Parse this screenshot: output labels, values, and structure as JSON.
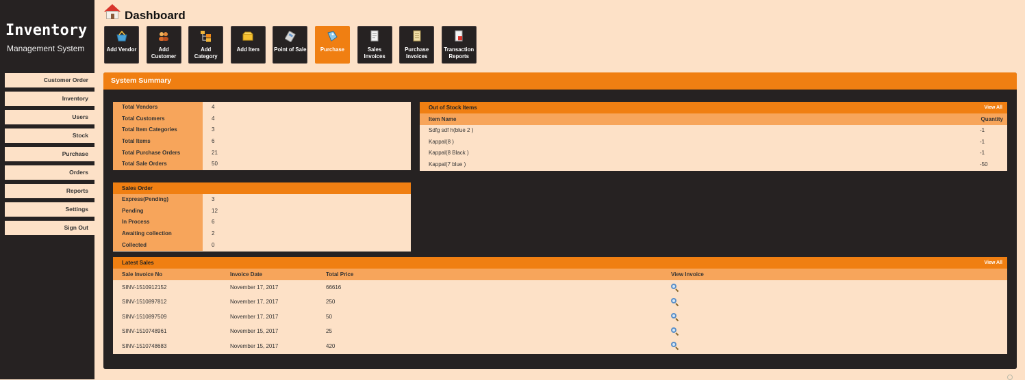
{
  "brand": {
    "title": "Inventory",
    "subtitle": "Management System"
  },
  "sidebar": {
    "items": [
      {
        "label": "Customer Order"
      },
      {
        "label": "Inventory"
      },
      {
        "label": "Users"
      },
      {
        "label": "Stock"
      },
      {
        "label": "Purchase"
      },
      {
        "label": "Orders"
      },
      {
        "label": "Reports"
      },
      {
        "label": "Settings"
      },
      {
        "label": "Sign Out"
      }
    ]
  },
  "header": {
    "title": "Dashboard",
    "icon": "house-icon"
  },
  "quick_actions": [
    {
      "label": "Add Vendor",
      "icon": "basket-icon",
      "active": false
    },
    {
      "label": "Add Customer",
      "icon": "users-icon",
      "active": false
    },
    {
      "label": "Add Category",
      "icon": "category-icon",
      "active": false
    },
    {
      "label": "Add Item",
      "icon": "box-icon",
      "active": false
    },
    {
      "label": "Point of Sale",
      "icon": "card-icon",
      "active": false
    },
    {
      "label": "Purchase",
      "icon": "tag-icon",
      "active": true
    },
    {
      "label": "Sales Invoices",
      "icon": "document-icon",
      "active": false
    },
    {
      "label": "Purchase Invoices",
      "icon": "invoice-icon",
      "active": false
    },
    {
      "label": "Transaction Reports",
      "icon": "report-icon",
      "active": false
    }
  ],
  "summary": {
    "title": "System Summary",
    "totals": [
      {
        "label": "Total Vendors",
        "value": "4"
      },
      {
        "label": "Total Customers",
        "value": "4"
      },
      {
        "label": "Total Item Categories",
        "value": "3"
      },
      {
        "label": "Total Items",
        "value": "6"
      },
      {
        "label": "Total Purchase Orders",
        "value": "21"
      },
      {
        "label": "Total Sale Orders",
        "value": "50"
      }
    ],
    "sales_order": {
      "title": "Sales Order",
      "rows": [
        {
          "label": "Express(Pending)",
          "value": "3"
        },
        {
          "label": "Pending",
          "value": "12"
        },
        {
          "label": "In Process",
          "value": "6"
        },
        {
          "label": "Awaiting collection",
          "value": "2"
        },
        {
          "label": "Collected",
          "value": "0"
        }
      ]
    },
    "out_of_stock": {
      "title": "Out of Stock Items",
      "view_all": "View All",
      "columns": [
        "Item Name",
        "Quantity"
      ],
      "rows": [
        {
          "name": "Sdfg sdf h(blue 2 )",
          "qty": "-1"
        },
        {
          "name": "Kappal(8 )",
          "qty": "-1"
        },
        {
          "name": "Kappal(8 Black )",
          "qty": "-1"
        },
        {
          "name": "Kappal(7 blue )",
          "qty": "-50"
        }
      ]
    },
    "latest_sales": {
      "title": "Latest Sales",
      "view_all": "View All",
      "columns": [
        "Sale Invoice No",
        "Invoice Date",
        "Total Price",
        "View Invoice"
      ],
      "rows": [
        {
          "invoice": "SINV-1510912152",
          "date": "November 17, 2017",
          "price": "66616"
        },
        {
          "invoice": "SINV-1510897812",
          "date": "November 17, 2017",
          "price": "250"
        },
        {
          "invoice": "SINV-1510897509",
          "date": "November 17, 2017",
          "price": "50"
        },
        {
          "invoice": "SINV-1510748961",
          "date": "November 15, 2017",
          "price": "25"
        },
        {
          "invoice": "SINV-1510748683",
          "date": "November 15, 2017",
          "price": "420"
        }
      ]
    }
  },
  "colors": {
    "accent": "#f07f12",
    "sidebar": "#262222",
    "background": "#fde1c7",
    "label_fill": "#f7a55b"
  }
}
